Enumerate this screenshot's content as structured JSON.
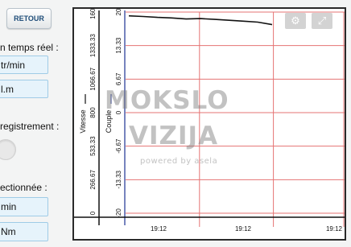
{
  "nav": {
    "back_label": "RETOUR"
  },
  "realtime": {
    "heading": "n temps réel :",
    "speed_value": "tr/min",
    "torque_value": "l.m"
  },
  "recording": {
    "heading": "registrement :"
  },
  "selection": {
    "heading": "ectionnée :",
    "speed_unit": "min",
    "torque_unit": "Nm"
  },
  "chart_data": {
    "type": "line",
    "left_axis": {
      "label": "Vitesse",
      "ticks": [
        "1600",
        "1333.33",
        "1066.67",
        "800",
        "533.33",
        "266.67",
        "0"
      ],
      "ylim": [
        0,
        1600
      ]
    },
    "right_axis": {
      "label": "Couple",
      "ticks": [
        "20",
        "13.33",
        "6.67",
        "0",
        "-6.67",
        "-13.33",
        "-20"
      ],
      "ylim": [
        -20,
        20
      ]
    },
    "x_ticks": [
      "19:12",
      "19:12",
      "19:12"
    ],
    "series": [
      {
        "axis": "left",
        "color": "#111111",
        "points": [
          [
            0,
            1570
          ],
          [
            0.1,
            1565
          ],
          [
            0.2,
            1558
          ],
          [
            0.3,
            1553
          ],
          [
            0.4,
            1545
          ],
          [
            0.5,
            1548
          ],
          [
            0.6,
            1542
          ],
          [
            0.7,
            1535
          ],
          [
            0.8,
            1528
          ],
          [
            0.9,
            1520
          ],
          [
            1.0,
            1500
          ]
        ]
      }
    ],
    "grid": true,
    "grid_color": "#e57373"
  },
  "chart_controls": {
    "settings_icon": "gear-icon",
    "expand_icon": "expand-icon"
  },
  "watermark": {
    "line1": "MOKSLO",
    "line2": "VIZIJA",
    "line3": "powered by asela"
  }
}
